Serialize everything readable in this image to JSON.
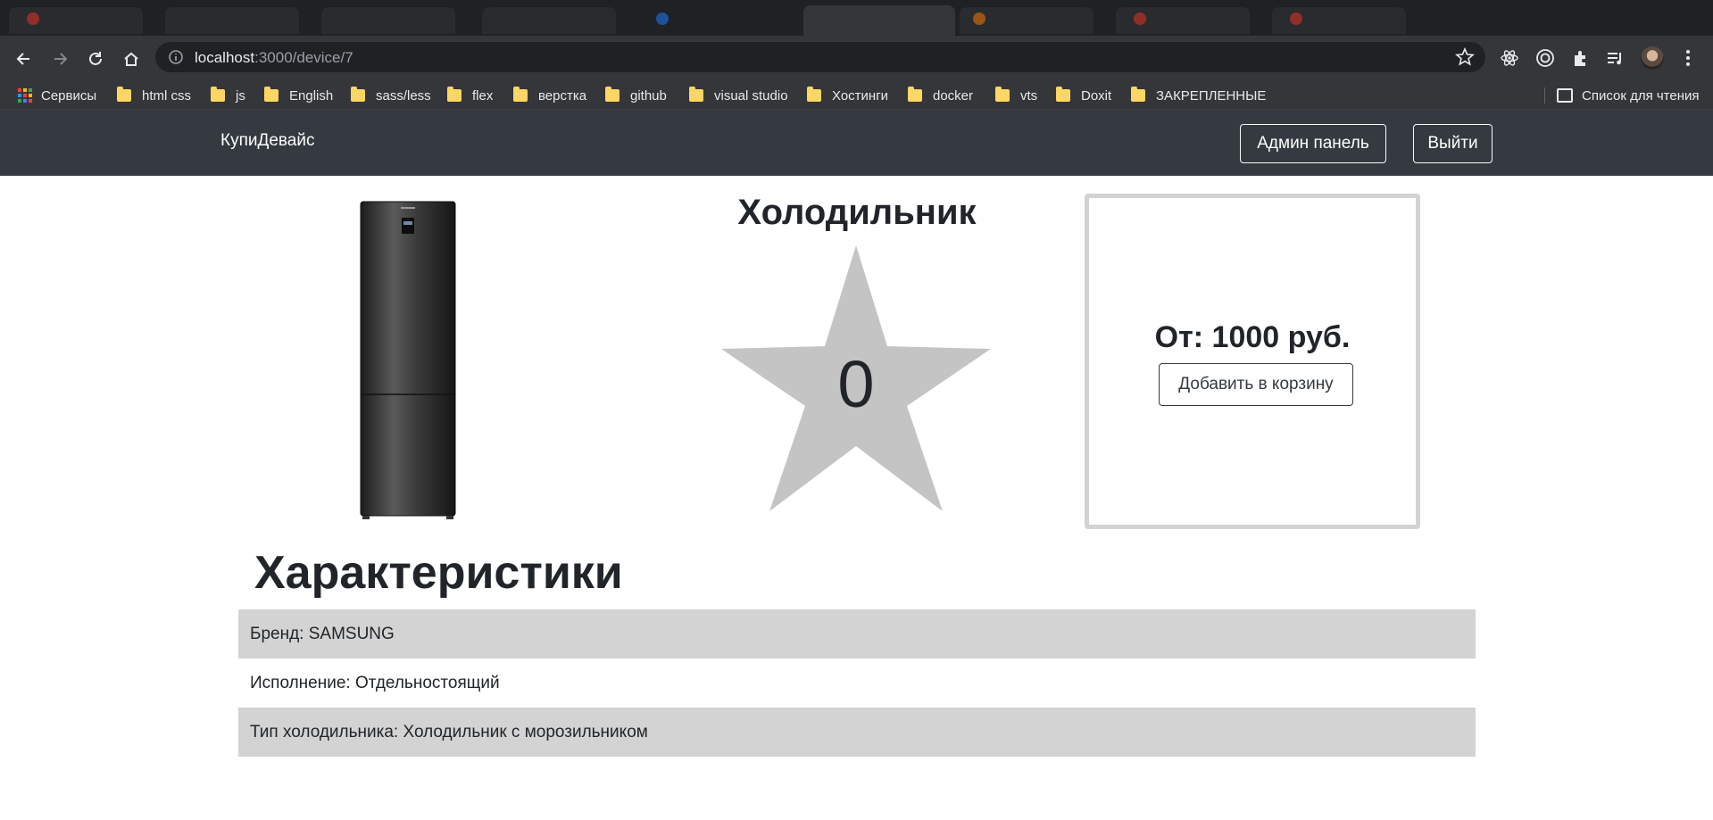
{
  "browser": {
    "url_host": "localhost",
    "url_rest": ":3000/device/7",
    "bookmarks": [
      {
        "label": "Сервисы",
        "type": "apps"
      },
      {
        "label": "html css",
        "type": "folder"
      },
      {
        "label": "js",
        "type": "folder"
      },
      {
        "label": "English",
        "type": "folder"
      },
      {
        "label": "sass/less",
        "type": "folder"
      },
      {
        "label": "flex",
        "type": "folder"
      },
      {
        "label": "верстка",
        "type": "folder"
      },
      {
        "label": "github",
        "type": "folder"
      },
      {
        "label": "visual studio",
        "type": "folder"
      },
      {
        "label": "Хостинги",
        "type": "folder"
      },
      {
        "label": "docker",
        "type": "folder"
      },
      {
        "label": "vts",
        "type": "folder"
      },
      {
        "label": "Doxit",
        "type": "folder"
      },
      {
        "label": "ЗАКРЕПЛЕННЫЕ",
        "type": "folder"
      }
    ],
    "reading_list": "Список для чтения"
  },
  "navbar": {
    "brand": "КупиДевайс",
    "admin_button": "Админ панель",
    "logout_button": "Выйти"
  },
  "product": {
    "name": "Холодильник",
    "rating": "0",
    "price": "От: 1000 руб.",
    "add_to_cart": "Добавить в корзину"
  },
  "specs": {
    "title": "Характеристики",
    "rows": [
      "Бренд: SAMSUNG",
      "Исполнение: Отдельностоящий",
      "Тип холодильника: Холодильник с морозильником"
    ]
  },
  "colors": {
    "navbar_bg": "#343a40",
    "row_shade": "#d3d3d3",
    "star": "#c4c4c4"
  }
}
